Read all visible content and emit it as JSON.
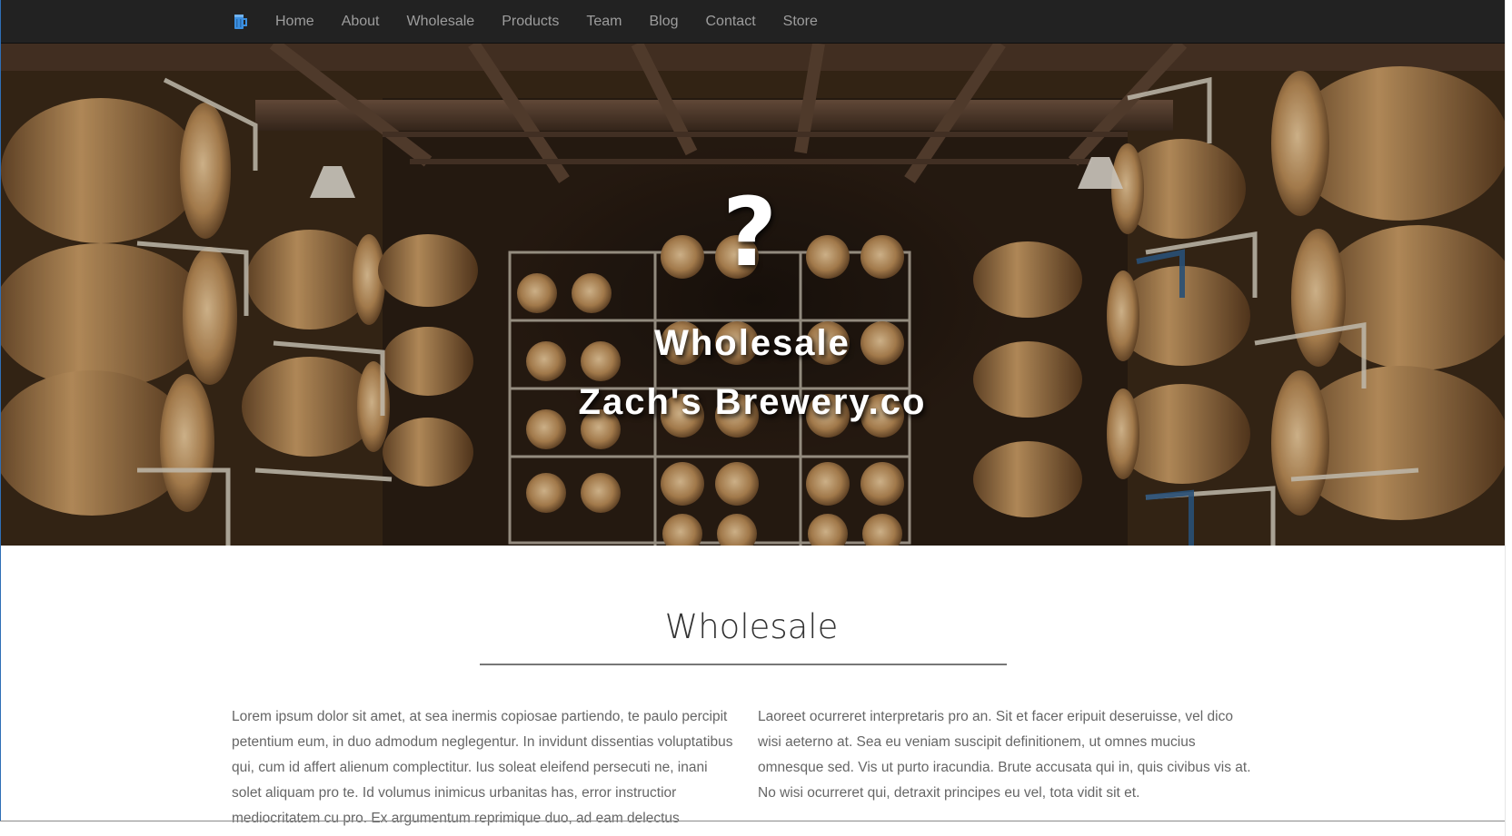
{
  "navbar": {
    "brand_icon": "beer-mug-icon",
    "items": [
      {
        "label": "Home"
      },
      {
        "label": "About"
      },
      {
        "label": "Wholesale"
      },
      {
        "label": "Products"
      },
      {
        "label": "Team"
      },
      {
        "label": "Blog"
      },
      {
        "label": "Contact"
      },
      {
        "label": "Store"
      }
    ]
  },
  "hero": {
    "icon": "question-mark-icon",
    "icon_glyph": "?",
    "title": "Wholesale",
    "subtitle": "Zach's Brewery.co",
    "background": "barrel-cellar-photo"
  },
  "section": {
    "heading": "Wholesale",
    "left_text": "Lorem ipsum dolor sit amet, at sea inermis copiosae partiendo, te paulo percipit petentium eum, in duo admodum neglegentur. In invidunt dissentias voluptatibus qui, cum id affert alienum complectitur. Ius soleat eleifend persecuti ne, inani solet aliquam pro te. Id volumus inimicus urbanitas has, error instructior mediocritatem cu pro. Ex argumentum reprimique duo, ad eam delectus electram",
    "right_text": "Laoreet ocurreret interpretaris pro an. Sit et facer eripuit deseruisse, vel dico wisi aeterno at. Sea eu veniam suscipit definitionem, ut omnes mucius omnesque sed. Vis ut purto iracundia. Brute accusata qui in, quis civibus vis at. No wisi ocurreret qui, detraxit principes eu vel, tota vidit sit et."
  },
  "colors": {
    "navbar_bg": "#222222",
    "nav_text": "#9d9d9d",
    "brand_icon": "#3b8fe0",
    "heading_text": "#333333",
    "body_text": "#666666"
  }
}
